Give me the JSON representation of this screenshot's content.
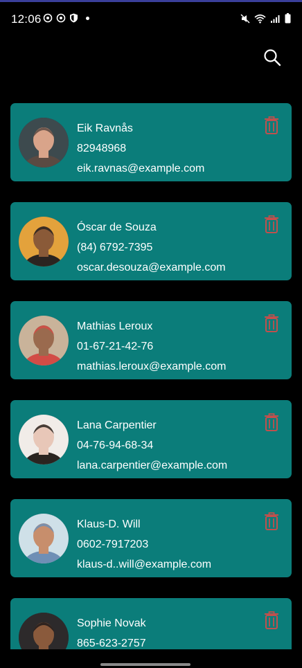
{
  "status_bar": {
    "time": "12:06"
  },
  "colors": {
    "card": "#0b7d7a",
    "delete_icon": "#c0504d",
    "background": "#000000"
  },
  "contacts": [
    {
      "name": "Eik Ravnås",
      "phone": "82948968",
      "email": "eik.ravnas@example.com",
      "avatar_colors": [
        "#3d4a4e",
        "#d9a48a",
        "#5a4a42"
      ]
    },
    {
      "name": "Óscar de Souza",
      "phone": "(84) 6792-7395",
      "email": "oscar.desouza@example.com",
      "avatar_colors": [
        "#e3a23c",
        "#8a5a38",
        "#2b2420"
      ]
    },
    {
      "name": "Mathias Leroux",
      "phone": "01-67-21-42-76",
      "email": "mathias.leroux@example.com",
      "avatar_colors": [
        "#c9b39a",
        "#9a6a4e",
        "#d24c46"
      ]
    },
    {
      "name": "Lana Carpentier",
      "phone": "04-76-94-68-34",
      "email": "lana.carpentier@example.com",
      "avatar_colors": [
        "#f1ece8",
        "#e8c7b8",
        "#2a2420"
      ]
    },
    {
      "name": "Klaus-D. Will",
      "phone": "0602-7917203",
      "email": "klaus-d..will@example.com",
      "avatar_colors": [
        "#cfe0e8",
        "#c78e6c",
        "#6f8fb5"
      ]
    },
    {
      "name": "Sophie Novak",
      "phone": "865-623-2757",
      "email": "",
      "avatar_colors": [
        "#2d2a2b",
        "#8a5a3c",
        "#1e1a1a"
      ]
    }
  ]
}
